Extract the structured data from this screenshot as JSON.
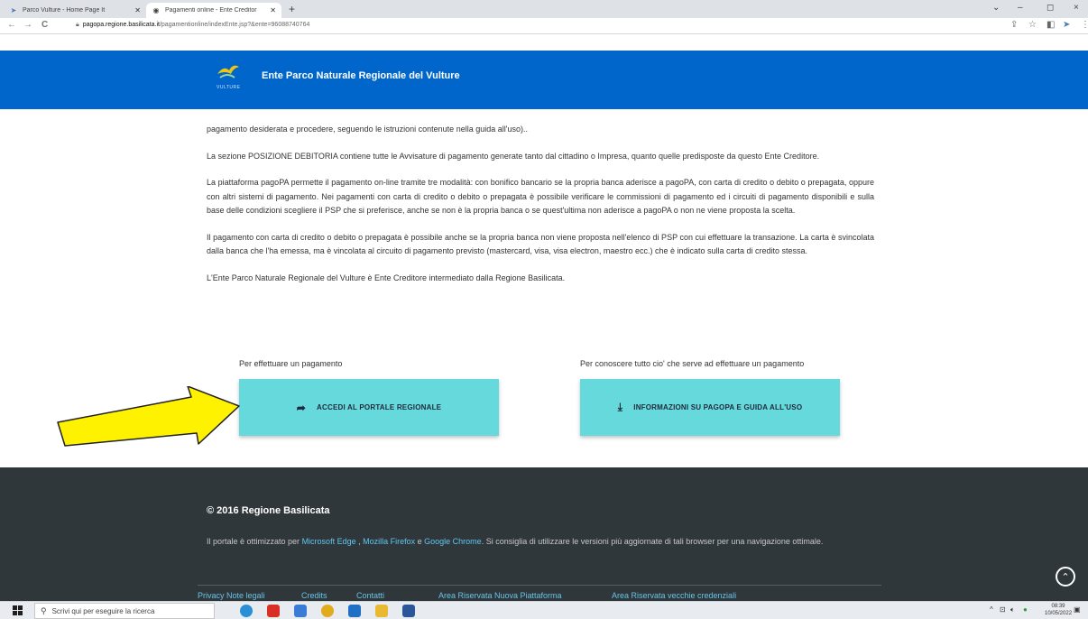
{
  "browser": {
    "tabs": [
      {
        "title": "Parco Vulture - Home Page It",
        "active": false
      },
      {
        "title": "Pagamenti online - Ente Creditor",
        "active": true
      }
    ],
    "url_host": "pagopa.regione.basilicata.it",
    "url_path": "/pagamentionline/indexEnte.jsp?&ente=96088740764",
    "new_tab": "+",
    "win_min": "–",
    "win_max": "◻",
    "win_close": "×",
    "nav_back": "←",
    "nav_forward": "→",
    "nav_reload": "C"
  },
  "header": {
    "logo_text": "VULTURE",
    "title": "Ente Parco Naturale Regionale del Vulture"
  },
  "content": {
    "paragraphs": [
      "pagamento desiderata e procedere, seguendo le istruzioni contenute nella guida all'uso)..",
      "La sezione POSIZIONE DEBITORIA contiene tutte le Avvisature di pagamento generate tanto dal cittadino o Impresa, quanto quelle predisposte da questo Ente Creditore.",
      "La piattaforma pagoPA permette il pagamento on-line tramite tre modalità: con bonifico bancario se la propria banca aderisce a pagoPA, con carta di credito o debito o prepagata, oppure con altri sistemi di pagamento. Nei pagamenti con carta di credito o debito o prepagata è possibile verificare le commissioni di pagamento ed i circuiti di pagamento disponibili e sulla base delle condizioni scegliere il PSP che si preferisce, anche se non è la propria banca o se quest'ultima non aderisce a pagoPA o non ne viene proposta la scelta.",
      "Il pagamento con carta di credito o debito o prepagata è possibile anche se la propria banca non viene proposta nell'elenco di PSP con cui effettuare la transazione. La carta è svincolata dalla banca che l'ha emessa, ma è vincolata al circuito di pagamento previsto (mastercard, visa, visa electron, maestro ecc.) che è indicato sulla carta di credito stessa.",
      "L'Ente Parco Naturale Regionale del Vulture è Ente Creditore intermediato dalla Regione Basilicata."
    ],
    "cta_left_label": "Per effettuare un pagamento",
    "cta_left_button": "ACCEDI AL PORTALE REGIONALE",
    "cta_right_label": "Per conoscere tutto cio' che serve ad effettuare un pagamento",
    "cta_right_button": "INFORMAZIONI SU PAGOPA E GUIDA ALL'USO"
  },
  "footer": {
    "copyright": "© 2016 Regione Basilicata",
    "note_prefix": "Il portale è ottimizzato per ",
    "browser1": "Microsoft Edge",
    "sep1": " , ",
    "browser2": "Mozilla Firefox",
    "sep2": " e ",
    "browser3": "Google Chrome",
    "note_suffix": ". Si consiglia di utilizzare le versioni più aggiornate di tali browser per una navigazione ottimale.",
    "links": [
      "Privacy Note legali",
      "Credits",
      "Contatti",
      "Area Riservata Nuova Piattaforma",
      "Area Riservata vecchie credenziali"
    ]
  },
  "taskbar": {
    "search_placeholder": "Scrivi qui per eseguire la ricerca",
    "time": "08:39",
    "date": "10/05/2022"
  },
  "colors": {
    "header_blue": "#0066cc",
    "cta_cyan": "#66d9dd",
    "footer_dark": "#30373b",
    "arrow_yellow": "#fff200",
    "link_blue": "#5ec7f0"
  }
}
